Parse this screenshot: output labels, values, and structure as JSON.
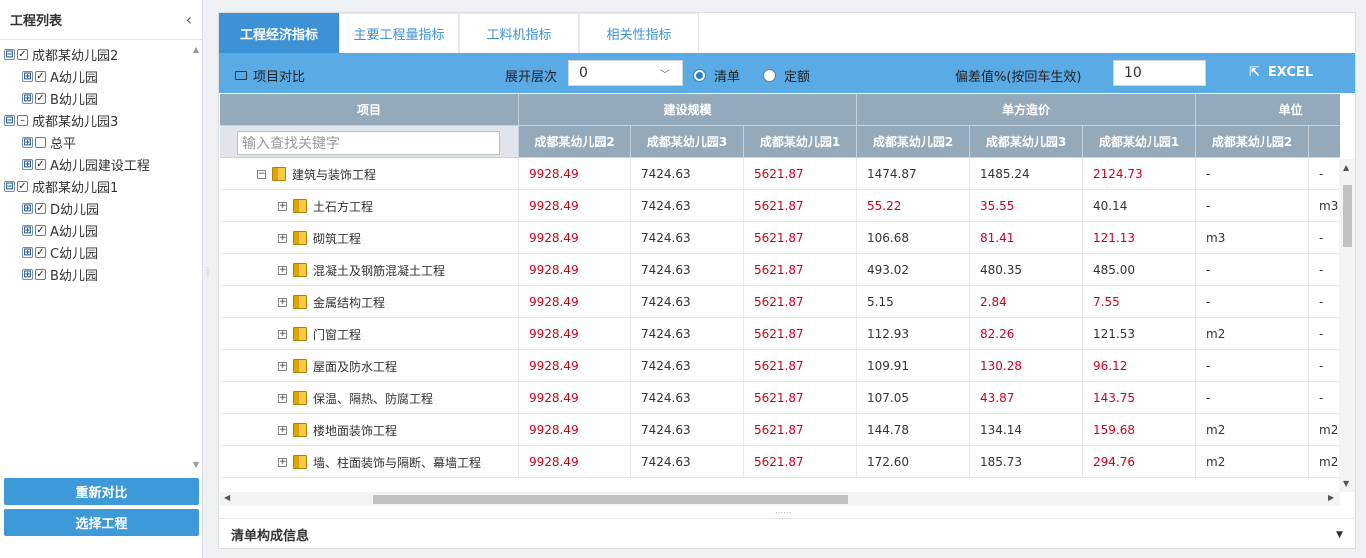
{
  "left_panel": {
    "title": "工程列表",
    "tree": [
      {
        "label": "成都某幼儿园2",
        "level": 0,
        "exp": "⊟",
        "cb": "✓"
      },
      {
        "label": "A幼儿园",
        "level": 1,
        "exp": "⊞",
        "cb": "✓"
      },
      {
        "label": "B幼儿园",
        "level": 1,
        "exp": "⊞",
        "cb": "✓"
      },
      {
        "label": "成都某幼儿园3",
        "level": 0,
        "exp": "⊟",
        "cb": "–"
      },
      {
        "label": "总平",
        "level": 1,
        "exp": "⊞",
        "cb": ""
      },
      {
        "label": "A幼儿园建设工程",
        "level": 1,
        "exp": "⊞",
        "cb": "✓"
      },
      {
        "label": "成都某幼儿园1",
        "level": 0,
        "exp": "⊟",
        "cb": "✓"
      },
      {
        "label": "D幼儿园",
        "level": 1,
        "exp": "⊞",
        "cb": "✓"
      },
      {
        "label": "A幼儿园",
        "level": 1,
        "exp": "⊞",
        "cb": "✓"
      },
      {
        "label": "C幼儿园",
        "level": 1,
        "exp": "⊞",
        "cb": "✓"
      },
      {
        "label": "B幼儿园",
        "level": 1,
        "exp": "⊞",
        "cb": "✓"
      }
    ],
    "recompare_label": "重新对比",
    "select_project_label": "选择工程"
  },
  "tabs": [
    "工程经济指标",
    "主要工程量指标",
    "工料机指标",
    "相关性指标"
  ],
  "toolbar": {
    "project_compare": "项目对比",
    "expand_level_label": "展开层次",
    "expand_level_value": "0",
    "radio_list": "清单",
    "radio_quota": "定额",
    "deviation_label": "偏差值%(按回车生效)",
    "deviation_value": "10",
    "excel_label": "EXCEL"
  },
  "table": {
    "group_headers": [
      "项目",
      "建设规模",
      "单方造价",
      "单位"
    ],
    "search_placeholder": "输入查找关键字",
    "sub_headers": [
      "成都某幼儿园2",
      "成都某幼儿园3",
      "成都某幼儿园1",
      "成都某幼儿园2",
      "成都某幼儿园3",
      "成都某幼儿园1",
      "成都某幼儿园2",
      "成"
    ],
    "rows": [
      {
        "name": "建筑与装饰工程",
        "level": 0,
        "exp": "⊟",
        "cells": [
          [
            "9928.49",
            "red"
          ],
          [
            "7424.63",
            ""
          ],
          [
            "5621.87",
            "red"
          ],
          [
            "1474.87",
            ""
          ],
          [
            "1485.24",
            ""
          ],
          [
            "2124.73",
            "red"
          ],
          [
            "-",
            ""
          ],
          [
            "-",
            ""
          ]
        ]
      },
      {
        "name": "土石方工程",
        "level": 1,
        "exp": "⊞",
        "cells": [
          [
            "9928.49",
            "red"
          ],
          [
            "7424.63",
            ""
          ],
          [
            "5621.87",
            "red"
          ],
          [
            "55.22",
            "red"
          ],
          [
            "35.55",
            "red"
          ],
          [
            "40.14",
            ""
          ],
          [
            "-",
            ""
          ],
          [
            "m3",
            ""
          ]
        ]
      },
      {
        "name": "砌筑工程",
        "level": 1,
        "exp": "⊞",
        "cells": [
          [
            "9928.49",
            "red"
          ],
          [
            "7424.63",
            ""
          ],
          [
            "5621.87",
            "red"
          ],
          [
            "106.68",
            ""
          ],
          [
            "81.41",
            "red"
          ],
          [
            "121.13",
            "red"
          ],
          [
            "m3",
            ""
          ],
          [
            "-",
            ""
          ]
        ]
      },
      {
        "name": "混凝土及钢筋混凝土工程",
        "level": 1,
        "exp": "⊞",
        "cells": [
          [
            "9928.49",
            "red"
          ],
          [
            "7424.63",
            ""
          ],
          [
            "5621.87",
            "red"
          ],
          [
            "493.02",
            ""
          ],
          [
            "480.35",
            ""
          ],
          [
            "485.00",
            ""
          ],
          [
            "-",
            ""
          ],
          [
            "-",
            ""
          ]
        ]
      },
      {
        "name": "金属结构工程",
        "level": 1,
        "exp": "⊞",
        "cells": [
          [
            "9928.49",
            "red"
          ],
          [
            "7424.63",
            ""
          ],
          [
            "5621.87",
            "red"
          ],
          [
            "5.15",
            ""
          ],
          [
            "2.84",
            "red"
          ],
          [
            "7.55",
            "red"
          ],
          [
            "-",
            ""
          ],
          [
            "-",
            ""
          ]
        ]
      },
      {
        "name": "门窗工程",
        "level": 1,
        "exp": "⊞",
        "cells": [
          [
            "9928.49",
            "red"
          ],
          [
            "7424.63",
            ""
          ],
          [
            "5621.87",
            "red"
          ],
          [
            "112.93",
            ""
          ],
          [
            "82.26",
            "red"
          ],
          [
            "121.53",
            ""
          ],
          [
            "m2",
            ""
          ],
          [
            "-",
            ""
          ]
        ]
      },
      {
        "name": "屋面及防水工程",
        "level": 1,
        "exp": "⊞",
        "cells": [
          [
            "9928.49",
            "red"
          ],
          [
            "7424.63",
            ""
          ],
          [
            "5621.87",
            "red"
          ],
          [
            "109.91",
            ""
          ],
          [
            "130.28",
            "red"
          ],
          [
            "96.12",
            "red"
          ],
          [
            "-",
            ""
          ],
          [
            "-",
            ""
          ]
        ]
      },
      {
        "name": "保温、隔热、防腐工程",
        "level": 1,
        "exp": "⊞",
        "cells": [
          [
            "9928.49",
            "red"
          ],
          [
            "7424.63",
            ""
          ],
          [
            "5621.87",
            "red"
          ],
          [
            "107.05",
            ""
          ],
          [
            "43.87",
            "red"
          ],
          [
            "143.75",
            "red"
          ],
          [
            "-",
            ""
          ],
          [
            "-",
            ""
          ]
        ]
      },
      {
        "name": "楼地面装饰工程",
        "level": 1,
        "exp": "⊞",
        "cells": [
          [
            "9928.49",
            "red"
          ],
          [
            "7424.63",
            ""
          ],
          [
            "5621.87",
            "red"
          ],
          [
            "144.78",
            ""
          ],
          [
            "134.14",
            ""
          ],
          [
            "159.68",
            "red"
          ],
          [
            "m2",
            ""
          ],
          [
            "m2",
            ""
          ]
        ]
      },
      {
        "name": "墙、柱面装饰与隔断、幕墙工程",
        "level": 1,
        "exp": "⊞",
        "cells": [
          [
            "9928.49",
            "red"
          ],
          [
            "7424.63",
            ""
          ],
          [
            "5621.87",
            "red"
          ],
          [
            "172.60",
            ""
          ],
          [
            "185.73",
            ""
          ],
          [
            "294.76",
            "red"
          ],
          [
            "m2",
            ""
          ],
          [
            "m2",
            ""
          ]
        ]
      }
    ]
  },
  "footer": {
    "title": "清单构成信息"
  },
  "colors": {
    "accent": "#3d92d6",
    "toolbar": "#5aaae6",
    "header": "#94aabb",
    "red": "#d0021b"
  }
}
